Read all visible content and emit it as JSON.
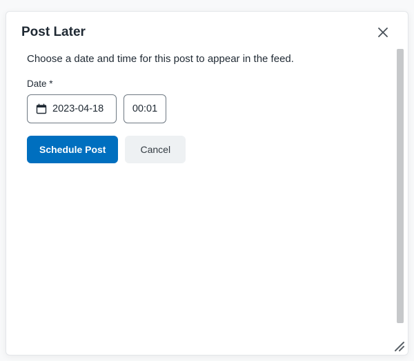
{
  "modal": {
    "title": "Post Later",
    "instruction": "Choose a date and time for this post to appear in the feed.",
    "date_label": "Date *",
    "date_value": "2023-04-18",
    "time_value": "00:01",
    "actions": {
      "schedule_label": "Schedule Post",
      "cancel_label": "Cancel"
    }
  }
}
